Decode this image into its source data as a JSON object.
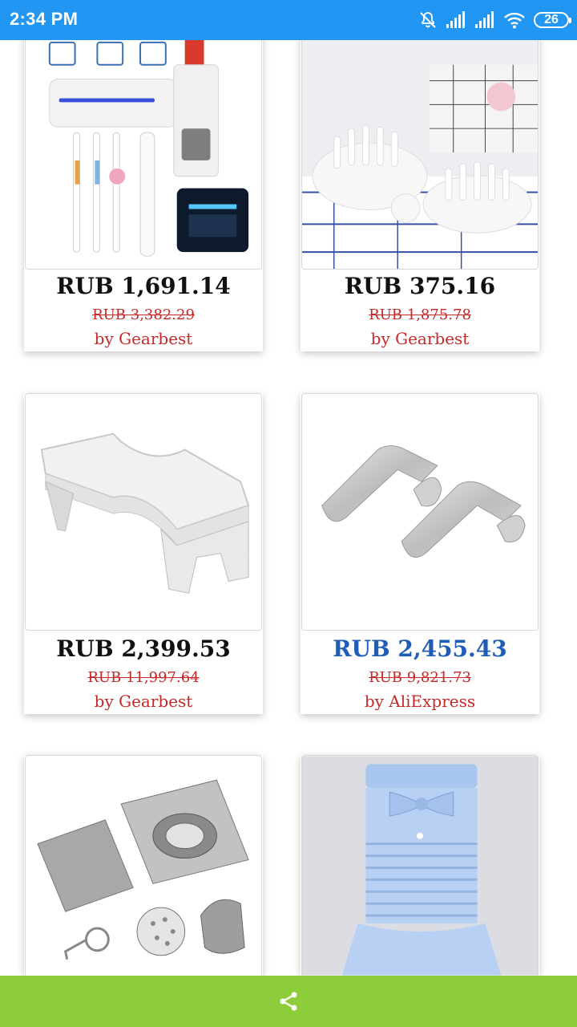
{
  "status_bar": {
    "time": "2:34 PM",
    "battery_level": "26",
    "icons": [
      "bell-off-icon",
      "signal-icon",
      "signal-icon",
      "wifi-icon",
      "battery-icon"
    ]
  },
  "products": [
    {
      "image": "uv-toothbrush-holder",
      "price": "RUB 1,691.14",
      "old_price": "RUB 3,382.29",
      "seller": "by Gearbest"
    },
    {
      "image": "scalp-massage-brushes",
      "price": "RUB 375.16",
      "old_price": "RUB 1,875.78",
      "seller": "by Gearbest"
    },
    {
      "image": "toilet-stool",
      "price": "RUB 2,399.53",
      "old_price": "RUB 11,997.64",
      "seller": "by Gearbest"
    },
    {
      "image": "door-hooks",
      "price": "RUB 2,455.43",
      "old_price": "RUB 9,821.73",
      "seller": "by AliExpress"
    },
    {
      "image": "floor-drain",
      "price": "",
      "old_price": "",
      "seller": ""
    },
    {
      "image": "hand-towel",
      "price": "",
      "old_price": "",
      "seller": ""
    }
  ],
  "bottom_bar": {
    "icon": "share-icon"
  },
  "colors": {
    "status_bar": "#2196f3",
    "bottom_bar": "#8dcc3a",
    "price_highlight": "#1e5eb8",
    "strike_price": "#c62828"
  }
}
